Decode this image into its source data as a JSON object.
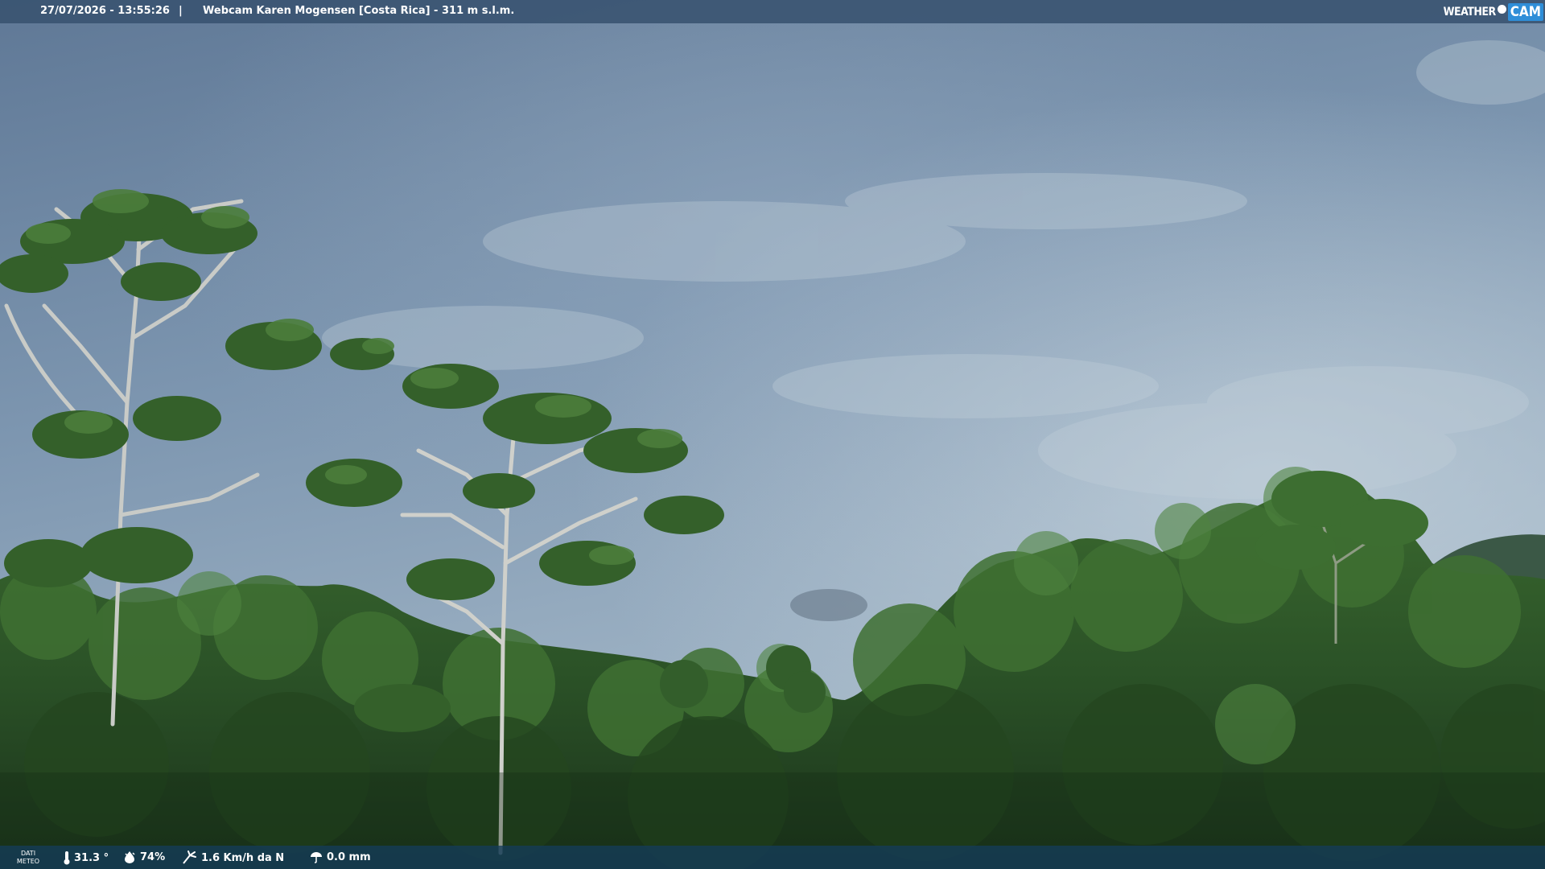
{
  "header": {
    "datetime": "27/07/2026 - 13:55:26",
    "separator": "|",
    "title": "Webcam Karen Mogensen [Costa Rica]  - 311 m s.l.m."
  },
  "logo": {
    "word": "WEATHER",
    "cam": "CAM"
  },
  "footer": {
    "meteo_label_1": "DATI",
    "meteo_label_2": "METEO",
    "temperature": "31.3 °",
    "humidity": "74%",
    "wind": "1.6 Km/h da N",
    "rain": "0.0 mm"
  },
  "icons": {
    "temperature": "thermometer-icon",
    "humidity": "humidity-icon",
    "wind": "wind-icon",
    "rain": "rain-icon"
  },
  "colors": {
    "sky_top": "#6e88a6",
    "sky_bottom": "#a3b8c9",
    "forest_dark": "#1f3d1e",
    "forest_light": "#3d6b2e",
    "overlay_top": "#385270",
    "overlay_bottom": "#143c5a",
    "logo_accent": "#2f8ed8"
  }
}
